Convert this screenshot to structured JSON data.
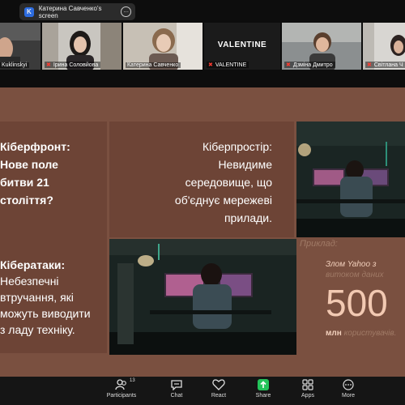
{
  "share": {
    "badge": "K",
    "title": "Катерина Савченко's screen",
    "more": "…"
  },
  "participants": [
    {
      "name": "Kuklinskyi"
    },
    {
      "name": "Ірина Соловйова"
    },
    {
      "name": "Катерина Савченко"
    },
    {
      "name": "VALENTINE",
      "display": "VALENTINE"
    },
    {
      "name": "Дзміна Дмитро"
    },
    {
      "name": "Світлана Ч"
    }
  ],
  "slide": {
    "block1": [
      "Кіберфронт:",
      "Нове поле",
      "битви 21",
      "століття?"
    ],
    "block2": [
      "Кіберпростір:",
      "Невидиме",
      "середовище, що",
      "об'єднує мережеві",
      "прилади."
    ],
    "block3": [
      "Кібератаки:",
      "Небезпечні",
      "втручання, які",
      "можуть виводити",
      "з ладу техніку."
    ],
    "example": {
      "label": "Приклад:",
      "line1": "Злом Yahoo з",
      "line2": "витоком даних",
      "number": "500",
      "line3_bold": "млн",
      "line3_rest": " користувачів."
    }
  },
  "toolbar": {
    "participants_label": "Participants",
    "participants_count": "13",
    "chat_label": "Chat",
    "react_label": "React",
    "share_label": "Share",
    "apps_label": "Apps",
    "more_label": "More",
    "share_color": "#23c35a"
  }
}
